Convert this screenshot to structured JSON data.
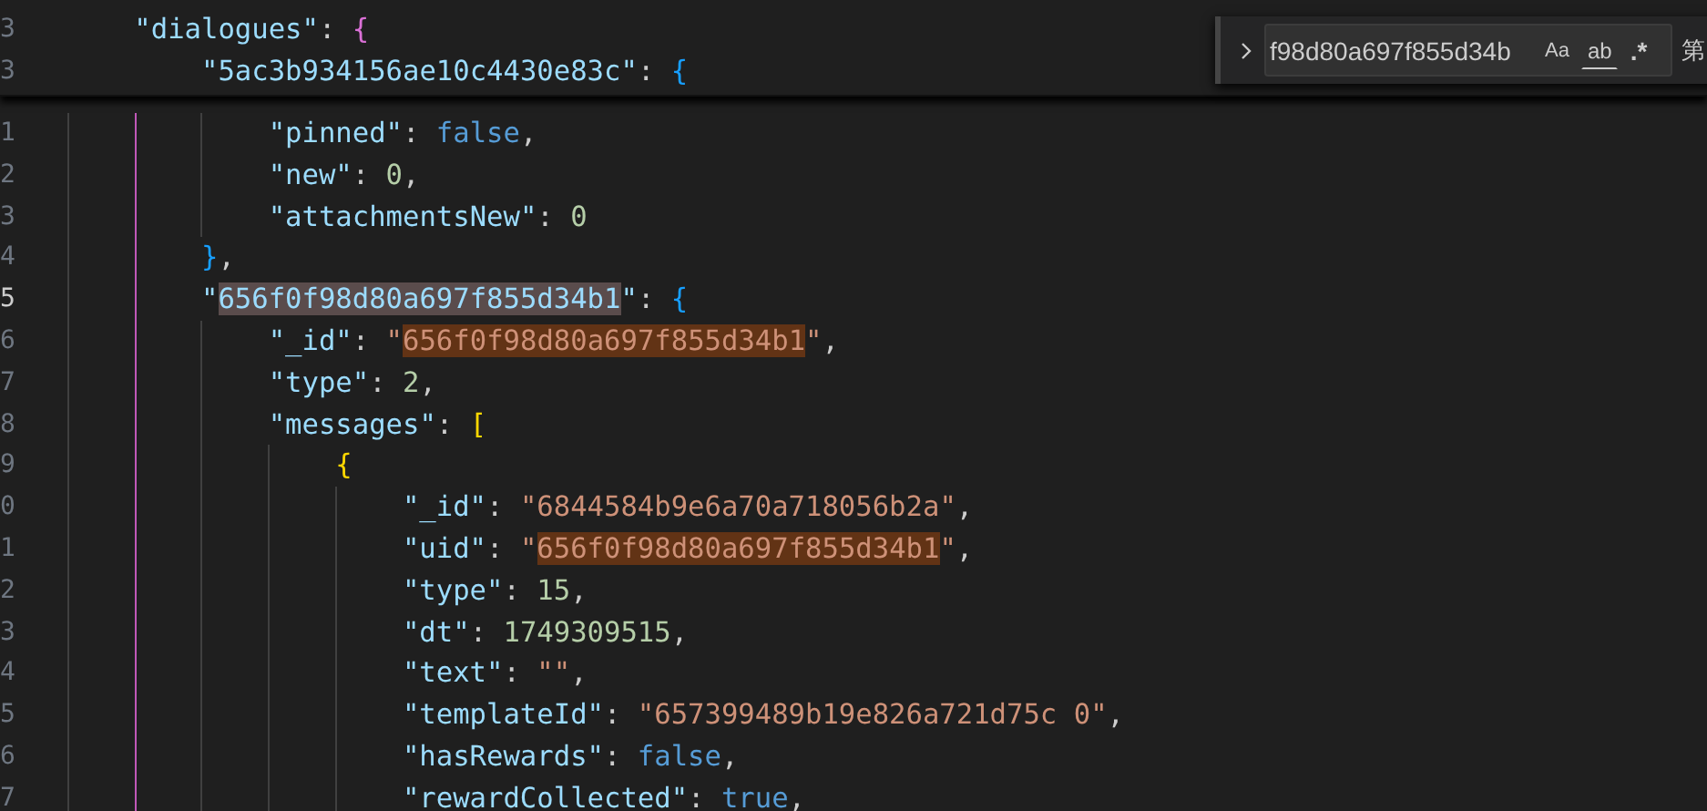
{
  "editor": {
    "sticky_lines": [
      {
        "children": [
          {
            "children": [
              {
                "number": "3",
                "current": false,
                "tokens": [
                  {
                    "kind": "key",
                    "text": "\"dialogues\""
                  },
                  {
                    "kind": "punct",
                    "text": ": "
                  },
                  {
                    "kind": "bracket",
                    "text": "{",
                    "color": "#da70d6"
                  }
                ],
                "children": [
                  {
                    "number": "3",
                    "current": false,
                    "tokens": [
                      {
                        "kind": "key",
                        "text": "\"5ac3b934156ae10c4430e83c\""
                      },
                      {
                        "kind": "punct",
                        "text": ": "
                      },
                      {
                        "kind": "bracket",
                        "text": "{",
                        "color": "#179fff"
                      }
                    ]
                  }
                ]
              }
            ]
          }
        ]
      }
    ],
    "lines": [
      {
        "children": [
          {
            "children": [
              {
                "children": [
                  {
                    "children": [
                      {
                        "number": "1",
                        "current": false,
                        "tokens": [
                          {
                            "kind": "key",
                            "text": "\"pinned\""
                          },
                          {
                            "kind": "punct",
                            "text": ": "
                          },
                          {
                            "kind": "boolean",
                            "text": "false"
                          },
                          {
                            "kind": "punct",
                            "text": ","
                          }
                        ]
                      },
                      {
                        "number": "2",
                        "current": false,
                        "tokens": [
                          {
                            "kind": "key",
                            "text": "\"new\""
                          },
                          {
                            "kind": "punct",
                            "text": ": "
                          },
                          {
                            "kind": "number",
                            "text": "0"
                          },
                          {
                            "kind": "punct",
                            "text": ","
                          }
                        ]
                      },
                      {
                        "number": "3",
                        "current": false,
                        "tokens": [
                          {
                            "kind": "key",
                            "text": "\"attachmentsNew\""
                          },
                          {
                            "kind": "punct",
                            "text": ": "
                          },
                          {
                            "kind": "number",
                            "text": "0"
                          }
                        ]
                      }
                    ]
                  },
                  {
                    "number": "4",
                    "current": false,
                    "tokens": [
                      {
                        "kind": "bracket",
                        "text": "}",
                        "color": "#179fff"
                      },
                      {
                        "kind": "punct",
                        "text": ","
                      }
                    ]
                  },
                  {
                    "number": "5",
                    "current": true,
                    "tokens": [
                      {
                        "kind": "key",
                        "text": "\""
                      },
                      {
                        "kind": "key",
                        "text": "656f0f98d80a697f855d34b1",
                        "selection": true
                      },
                      {
                        "kind": "key",
                        "text": "\""
                      },
                      {
                        "kind": "punct",
                        "text": ": "
                      },
                      {
                        "kind": "bracket",
                        "text": "{",
                        "color": "#179fff"
                      }
                    ],
                    "children": [
                      {
                        "number": "6",
                        "current": false,
                        "tokens": [
                          {
                            "kind": "key",
                            "text": "\"_id\""
                          },
                          {
                            "kind": "punct",
                            "text": ": "
                          },
                          {
                            "kind": "string",
                            "text": "\""
                          },
                          {
                            "kind": "string",
                            "text": "656f0f98d80a697f855d34b1",
                            "find_match": true
                          },
                          {
                            "kind": "string",
                            "text": "\""
                          },
                          {
                            "kind": "punct",
                            "text": ","
                          }
                        ]
                      },
                      {
                        "number": "7",
                        "current": false,
                        "tokens": [
                          {
                            "kind": "key",
                            "text": "\"type\""
                          },
                          {
                            "kind": "punct",
                            "text": ": "
                          },
                          {
                            "kind": "number",
                            "text": "2"
                          },
                          {
                            "kind": "punct",
                            "text": ","
                          }
                        ]
                      },
                      {
                        "number": "8",
                        "current": false,
                        "tokens": [
                          {
                            "kind": "key",
                            "text": "\"messages\""
                          },
                          {
                            "kind": "punct",
                            "text": ": "
                          },
                          {
                            "kind": "bracket",
                            "text": "[",
                            "color": "#ffd700"
                          }
                        ],
                        "children": [
                          {
                            "number": "9",
                            "current": false,
                            "tokens": [
                              {
                                "kind": "bracket",
                                "text": "{",
                                "color": "#ffd700"
                              }
                            ],
                            "children": [
                              {
                                "number": "0",
                                "current": false,
                                "tokens": [
                                  {
                                    "kind": "key",
                                    "text": "\"_id\""
                                  },
                                  {
                                    "kind": "punct",
                                    "text": ": "
                                  },
                                  {
                                    "kind": "string",
                                    "text": "\"6844584b9e6a70a718056b2a\""
                                  },
                                  {
                                    "kind": "punct",
                                    "text": ","
                                  }
                                ]
                              },
                              {
                                "number": "1",
                                "current": false,
                                "tokens": [
                                  {
                                    "kind": "key",
                                    "text": "\"uid\""
                                  },
                                  {
                                    "kind": "punct",
                                    "text": ": "
                                  },
                                  {
                                    "kind": "string",
                                    "text": "\""
                                  },
                                  {
                                    "kind": "string",
                                    "text": "656f0f98d80a697f855d34b1",
                                    "find_match": true
                                  },
                                  {
                                    "kind": "string",
                                    "text": "\""
                                  },
                                  {
                                    "kind": "punct",
                                    "text": ","
                                  }
                                ]
                              },
                              {
                                "number": "2",
                                "current": false,
                                "tokens": [
                                  {
                                    "kind": "key",
                                    "text": "\"type\""
                                  },
                                  {
                                    "kind": "punct",
                                    "text": ": "
                                  },
                                  {
                                    "kind": "number",
                                    "text": "15"
                                  },
                                  {
                                    "kind": "punct",
                                    "text": ","
                                  }
                                ]
                              },
                              {
                                "number": "3",
                                "current": false,
                                "tokens": [
                                  {
                                    "kind": "key",
                                    "text": "\"dt\""
                                  },
                                  {
                                    "kind": "punct",
                                    "text": ": "
                                  },
                                  {
                                    "kind": "number",
                                    "text": "1749309515"
                                  },
                                  {
                                    "kind": "punct",
                                    "text": ","
                                  }
                                ]
                              },
                              {
                                "number": "4",
                                "current": false,
                                "tokens": [
                                  {
                                    "kind": "key",
                                    "text": "\"text\""
                                  },
                                  {
                                    "kind": "punct",
                                    "text": ": "
                                  },
                                  {
                                    "kind": "string",
                                    "text": "\"\""
                                  },
                                  {
                                    "kind": "punct",
                                    "text": ","
                                  }
                                ]
                              },
                              {
                                "number": "5",
                                "current": false,
                                "tokens": [
                                  {
                                    "kind": "key",
                                    "text": "\"templateId\""
                                  },
                                  {
                                    "kind": "punct",
                                    "text": ": "
                                  },
                                  {
                                    "kind": "string",
                                    "text": "\"657399489b19e826a721d75c 0\""
                                  },
                                  {
                                    "kind": "punct",
                                    "text": ","
                                  }
                                ]
                              },
                              {
                                "number": "6",
                                "current": false,
                                "tokens": [
                                  {
                                    "kind": "key",
                                    "text": "\"hasRewards\""
                                  },
                                  {
                                    "kind": "punct",
                                    "text": ": "
                                  },
                                  {
                                    "kind": "boolean",
                                    "text": "false"
                                  },
                                  {
                                    "kind": "punct",
                                    "text": ","
                                  }
                                ]
                              },
                              {
                                "number": "7",
                                "current": false,
                                "tokens": [
                                  {
                                    "kind": "key",
                                    "text": "\"rewardCollected\""
                                  },
                                  {
                                    "kind": "punct",
                                    "text": ": "
                                  },
                                  {
                                    "kind": "boolean",
                                    "text": "true"
                                  },
                                  {
                                    "kind": "punct",
                                    "text": ","
                                  }
                                ]
                              }
                            ]
                          }
                        ]
                      }
                    ]
                  }
                ]
              }
            ]
          }
        ]
      }
    ]
  },
  "find_widget": {
    "expanded": false,
    "value": "f98d80a697f855d34b",
    "options": [
      {
        "kind": "match-case",
        "label": "Aa",
        "on": false
      },
      {
        "kind": "whole-word",
        "label": "ab",
        "on": false
      },
      {
        "kind": "regex",
        "label": ".*",
        "on": false
      }
    ],
    "result_count": "第"
  }
}
